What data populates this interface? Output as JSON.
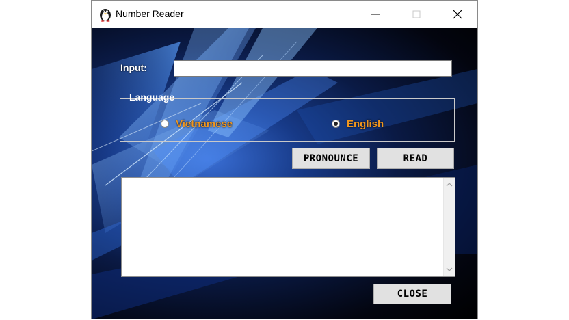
{
  "window": {
    "title": "Number Reader",
    "icon": "penguin-app-icon",
    "controls": [
      "minimize-icon",
      "maximize-icon",
      "close-icon"
    ]
  },
  "form": {
    "input_label": "Input:",
    "input_value": "",
    "language_group_label": "Language",
    "language_options": [
      {
        "label": "Vietnamese",
        "selected": false
      },
      {
        "label": "English",
        "selected": true
      }
    ],
    "pronounce_label": "PRONOUNCE",
    "read_label": "READ",
    "output_text": "",
    "close_label": "CLOSE"
  },
  "colors": {
    "radio_label": "#f0961e",
    "button_face": "#e1e1e1",
    "background_blue": "#173a88"
  }
}
